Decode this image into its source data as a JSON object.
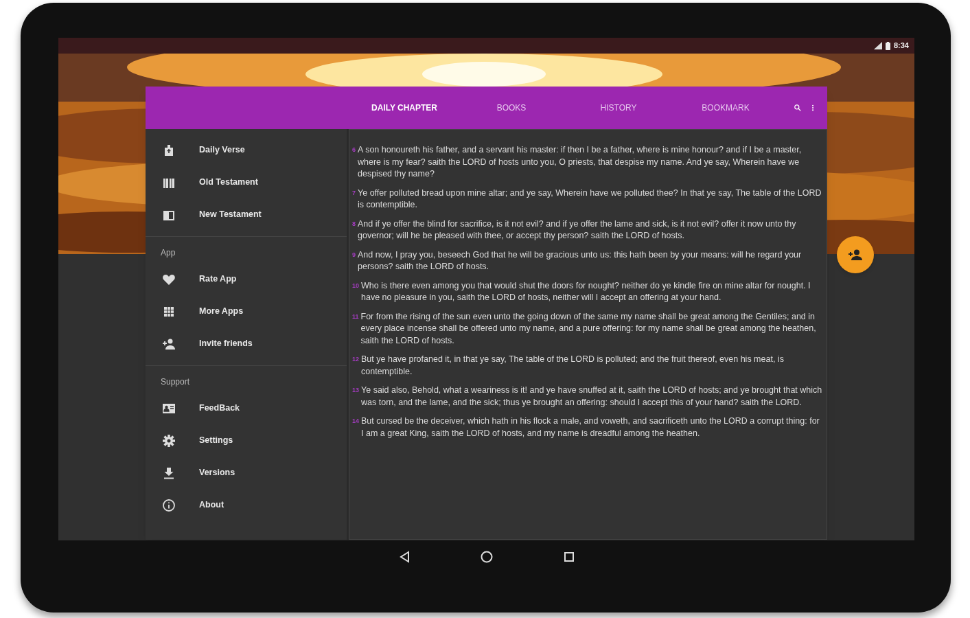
{
  "status_bar": {
    "time": "8:34"
  },
  "tabs": [
    {
      "label": "DAILY CHAPTER",
      "selected": true
    },
    {
      "label": "BOOKS",
      "selected": false
    },
    {
      "label": "HISTORY",
      "selected": false
    },
    {
      "label": "BOOKMARK",
      "selected": false
    }
  ],
  "sidebar": {
    "sections": [
      {
        "items": [
          {
            "label": "Daily Verse"
          },
          {
            "label": "Old Testament"
          },
          {
            "label": "New Testament"
          }
        ]
      },
      {
        "header": "App",
        "items": [
          {
            "label": "Rate App"
          },
          {
            "label": "More Apps"
          },
          {
            "label": "Invite friends"
          }
        ]
      },
      {
        "header": "Support",
        "items": [
          {
            "label": "FeedBack"
          },
          {
            "label": "Settings"
          },
          {
            "label": "Versions"
          },
          {
            "label": "About"
          }
        ]
      }
    ]
  },
  "verses": [
    {
      "number": "6",
      "text": "A son honoureth his father, and a servant his master: if then I be a father, where is mine honour? and if I be a master, where is my fear? saith the LORD of hosts unto you, O priests, that despise my name. And ye say, Wherein have we despised thy name?"
    },
    {
      "number": "7",
      "text": "Ye offer polluted bread upon mine altar; and ye say, Wherein have we polluted thee? In that ye say, The table of the LORD is contemptible."
    },
    {
      "number": "8",
      "text": "And if ye offer the blind for sacrifice, is it not evil? and if ye offer the lame and sick, is it not evil? offer it now unto thy governor; will he be pleased with thee, or accept thy person? saith the LORD of hosts."
    },
    {
      "number": "9",
      "text": "And now, I pray you, beseech God that he will be gracious unto us: this hath been by your means: will he regard your persons? saith the LORD of hosts."
    },
    {
      "number": "10",
      "text": "Who is there even among you that would shut the doors for nought? neither do ye kindle fire on mine altar for nought. I have no pleasure in you, saith the LORD of hosts, neither will I accept an offering at your hand."
    },
    {
      "number": "11",
      "text": "For from the rising of the sun even unto the going down of the same my name shall be great among the Gentiles; and in every place incense shall be offered unto my name, and a pure offering: for my name shall be great among the heathen, saith the LORD of hosts."
    },
    {
      "number": "12",
      "text": "But ye have profaned it, in that ye say, The table of the LORD is polluted; and the fruit thereof, even his meat, is contemptible."
    },
    {
      "number": "13",
      "text": "Ye said also, Behold, what a weariness is it! and ye have snuffed at it, saith the LORD of hosts; and ye brought that which was torn, and the lame, and the sick; thus ye brought an offering: should I accept this of your hand? saith the LORD."
    },
    {
      "number": "14",
      "text": "But cursed be the deceiver, which hath in his flock a male, and voweth, and sacrificeth unto the LORD a corrupt thing: for I am a great King, saith the LORD of hosts, and my name is dreadful among the heathen."
    }
  ]
}
